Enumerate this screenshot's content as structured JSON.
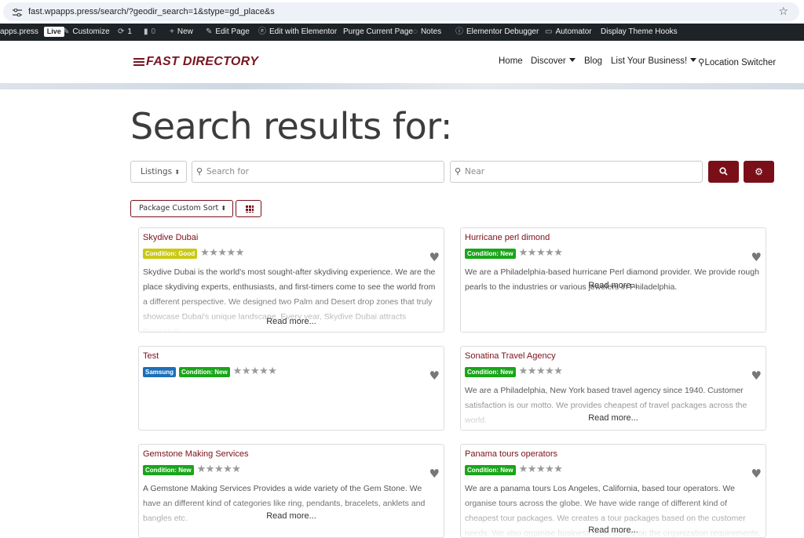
{
  "browser": {
    "url": "fast.wpapps.press/search/?geodir_search=1&stype=gd_place&s"
  },
  "adminbar": {
    "site": "apps.press",
    "live": "Live",
    "customize": "Customize",
    "updates": "1",
    "comments": "0",
    "new": "New",
    "edit_page": "Edit Page",
    "edit_elementor": "Edit with Elementor",
    "purge": "Purge Current Page",
    "notes": "Notes",
    "debugger": "Elementor Debugger",
    "automator": "Automator",
    "theme_hooks": "Display Theme Hooks"
  },
  "header": {
    "logo": "FAST DIRECTORY",
    "nav": [
      "Home",
      "Discover",
      "Blog",
      "List Your Business!",
      "Location Switcher"
    ]
  },
  "search": {
    "title": "Search results for:",
    "type_select": "Listings",
    "search_placeholder": "Search for",
    "near_placeholder": "Near",
    "sort_label": "Package Custom Sort"
  },
  "listings": [
    {
      "title": "Skydive Dubai",
      "badges": [
        "Condition: Good"
      ],
      "desc": "Skydive Dubai is the world's most sought-after skydiving experience. We are the place skydiving experts, enthusiasts, and first-timers come to see the world from a different perspective. We designed two Palm and Desert drop zones that truly showcase Dubai's unique landscape. Every year, Skydive Dubai attracts thousands",
      "read_more": "Read more..."
    },
    {
      "title": "Hurricane perl dimond",
      "badges": [
        "Condition: New"
      ],
      "desc": "We are a Philadelphia-based hurricane Perl diamond provider. We provide rough pearls to the industries or various jewelers in Philadelphia.",
      "read_more": "Read more..."
    },
    {
      "title": "Test",
      "badges": [
        "Samsung",
        "Condition: New"
      ],
      "desc": "",
      "read_more": ""
    },
    {
      "title": "Sonatina Travel Agency",
      "badges": [
        "Condition: New"
      ],
      "desc": "We are a Philadelphia, New York based travel agency since 1940. Customer satisfaction is our motto. We provides cheapest of travel packages across the world.",
      "read_more": "Read more..."
    },
    {
      "title": "Gemstone Making Services",
      "badges": [
        "Condition: New"
      ],
      "desc": "A Gemstone Making Services Provides a wide variety of the Gem Stone. We have an different kind of categories like ring, pendants, bracelets, anklets and bangles etc.",
      "read_more": "Read more..."
    },
    {
      "title": "Panama tours operators",
      "badges": [
        "Condition: New"
      ],
      "desc": "We are a panama tours Los Angeles, California, based tour operators. We organise tours across the globe. We have wide range of different kind of cheapest tour packages. We creates a tour packages based on the customer needs. We also organise business tours based on the organization requirements.",
      "read_more": "Read more..."
    }
  ],
  "colors": {
    "brand": "#7a0f1a",
    "badge_good": "#c9c912",
    "badge_new": "#1aa51a",
    "badge_samsung": "#1b6fba"
  }
}
